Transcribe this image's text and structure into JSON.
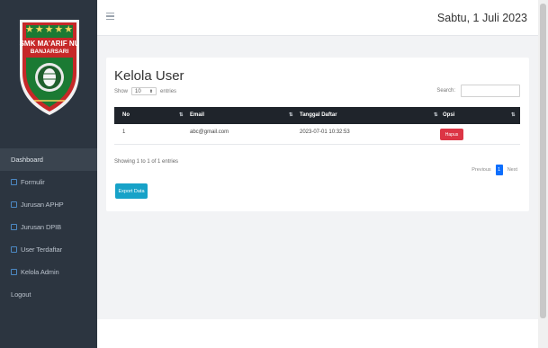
{
  "sidebar": {
    "logo": {
      "line1": "SMK MA'ARIF NU",
      "line2": "BANJARSARI",
      "stars": "★★★★★"
    },
    "items": [
      {
        "label": "Dashboard",
        "active": true,
        "icon": "file-icon"
      },
      {
        "label": "Formulir",
        "active": false,
        "icon": "file-icon"
      },
      {
        "label": "Jurusan APHP",
        "active": false,
        "icon": "file-icon"
      },
      {
        "label": "Jurusan DPIB",
        "active": false,
        "icon": "file-icon"
      },
      {
        "label": "User Terdaftar",
        "active": false,
        "icon": "file-icon"
      },
      {
        "label": "Kelola Admin",
        "active": false,
        "icon": "file-icon"
      },
      {
        "label": "Logout",
        "active": false,
        "icon": ""
      }
    ]
  },
  "header": {
    "date": "Sabtu, 1 Juli 2023"
  },
  "main": {
    "title": "Kelola User",
    "show_label": "Show",
    "entries_value": "10",
    "entries_label": "entries",
    "search_label": "Search:",
    "table": {
      "headers": [
        "No",
        "Email",
        "Tanggal Daftar",
        "Opsi"
      ],
      "rows": [
        {
          "no": "1",
          "email": "abc@gmail.com",
          "tanggal": "2023-07-01 10:32:53",
          "action": "Hapus"
        }
      ]
    },
    "showing_text": "Showing 1 to 1 of 1 entries",
    "pagination": {
      "previous": "Previous",
      "current": "1",
      "next": "Next"
    },
    "export_label": "Export Data"
  },
  "colors": {
    "sidebar": "#2c3540",
    "table_header": "#1f242b",
    "danger": "#dc3545",
    "primary": "#0d6efd",
    "info": "#17a2c8"
  }
}
